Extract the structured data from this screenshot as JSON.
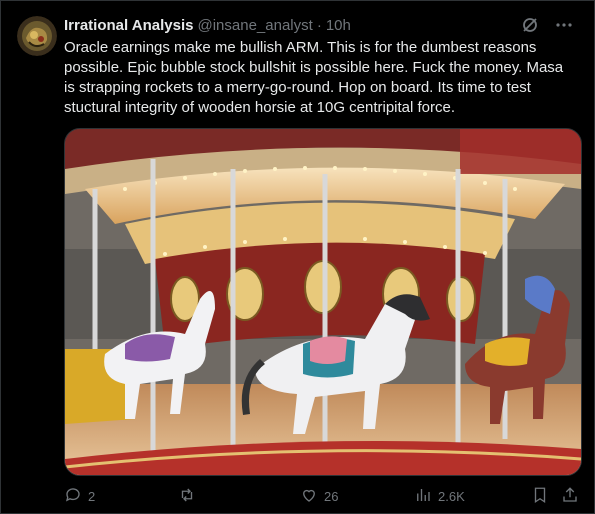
{
  "tweet": {
    "display_name": "Irrational Analysis",
    "handle": "@insane_analyst",
    "separator": "·",
    "time": "10h",
    "text": "Oracle earnings make me bullish ARM. This is for the dumbest reasons possible. Epic bubble stock bullshit is possible here. Fuck the money. Masa is strapping rockets to a merry-go-round. Hop on board. Its time to test stuctural integrity of wooden horsie at 10G centripital force."
  },
  "media": {
    "subject": "carousel-photo"
  },
  "actions": {
    "replies": "2",
    "reposts": "",
    "likes": "26",
    "views": "2.6K"
  },
  "icons": {
    "grok": "slashed-circle-icon",
    "more": "more-icon",
    "reply": "reply-icon",
    "repost": "repost-icon",
    "like": "heart-icon",
    "views": "views-icon",
    "bookmark": "bookmark-icon",
    "share": "share-icon"
  },
  "colors": {
    "text": "#e7e9ea",
    "muted": "#71767b",
    "background": "#000000",
    "border": "#2f3336"
  }
}
